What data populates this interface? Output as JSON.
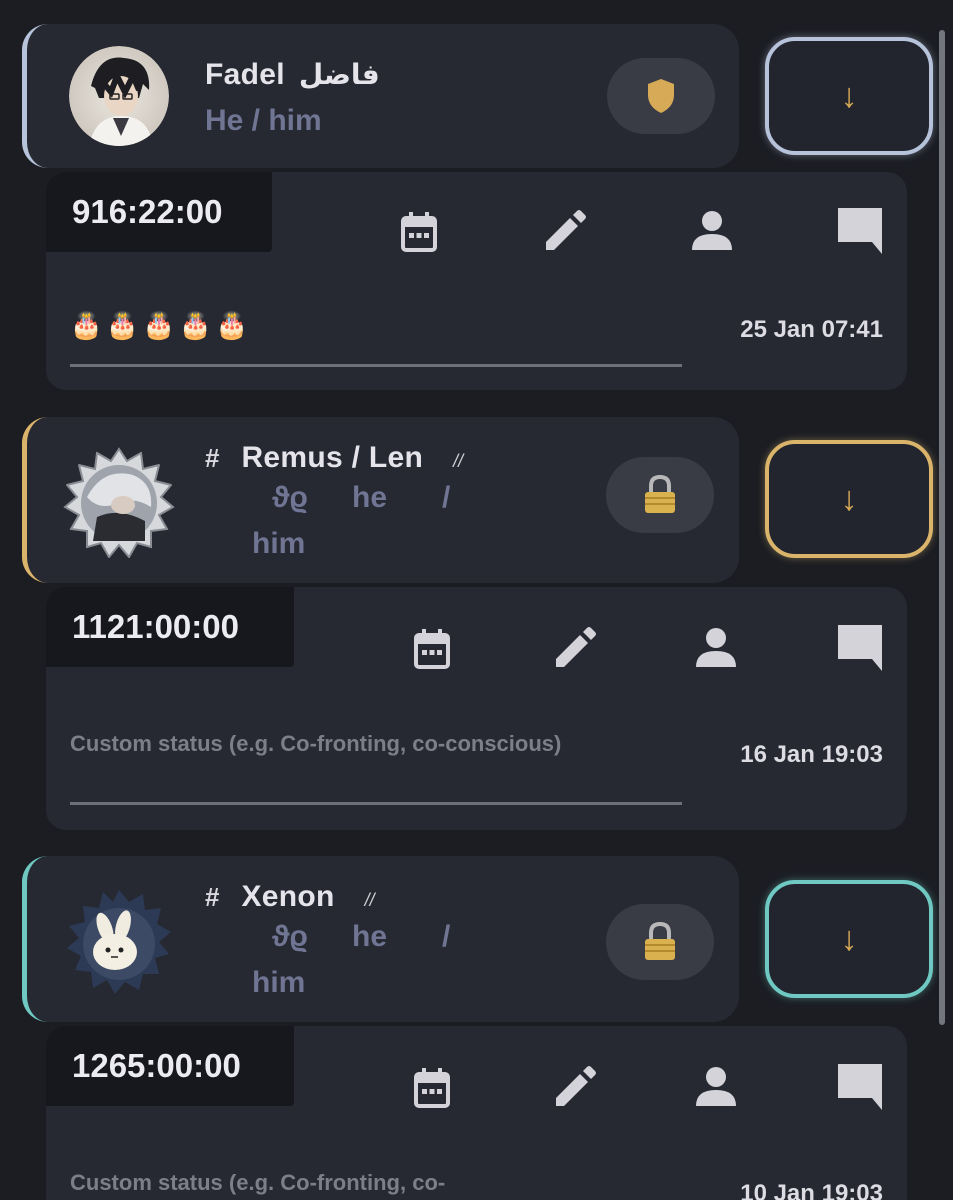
{
  "accent_colors": {
    "fadel": "#b7c3da",
    "remus": "#d9b46a",
    "xenon": "#6fc9c2"
  },
  "members": [
    {
      "name": "Fadel",
      "alt_name": "فاضل",
      "pronouns": "He / him",
      "badge_icon": "shield-icon",
      "jump_icon": "arrow-down-icon",
      "timer": "916:22:00",
      "status": "🎂🎂🎂🎂🎂",
      "timestamp": "25 Jan 07:41"
    },
    {
      "hash": "#",
      "name": "Remus / Len",
      "edit_mark": "//",
      "pronoun_parts": [
        "ϑϱ",
        "he",
        "/",
        "him"
      ],
      "badge_icon": "lock-icon",
      "jump_icon": "arrow-down-icon",
      "timer": "1121:00:00",
      "status_placeholder": "Custom status (e.g. Co-fronting, co-conscious)",
      "timestamp": "16 Jan 19:03"
    },
    {
      "hash": "#",
      "name": "Xenon",
      "edit_mark": "//",
      "pronoun_parts": [
        "ϑϱ",
        "he",
        "/",
        "him"
      ],
      "badge_icon": "lock-icon",
      "jump_icon": "arrow-down-icon",
      "timer": "1265:00:00",
      "status_placeholder": "Custom status (e.g. Co-fronting, co-",
      "timestamp": "10 Jan 19:03"
    }
  ],
  "action_icons": [
    "calendar-icon",
    "pencil-icon",
    "person-icon",
    "chat-icon"
  ],
  "jump_arrow": "↓"
}
